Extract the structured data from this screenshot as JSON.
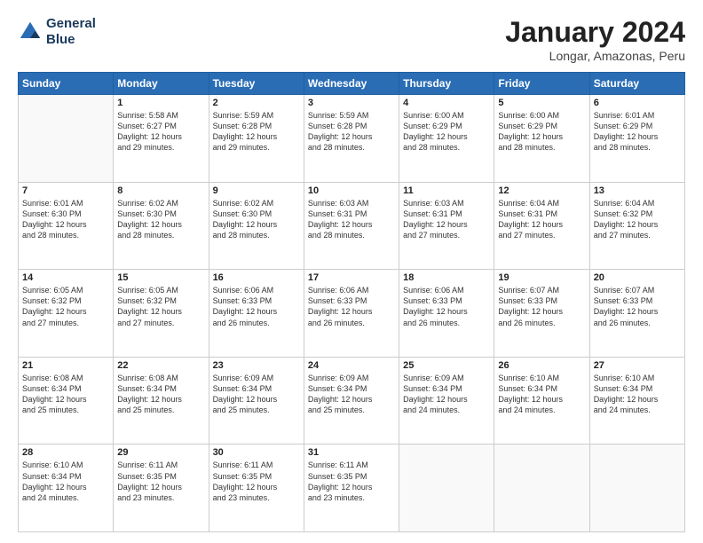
{
  "logo": {
    "line1": "General",
    "line2": "Blue"
  },
  "title": "January 2024",
  "subtitle": "Longar, Amazonas, Peru",
  "header": {
    "days": [
      "Sunday",
      "Monday",
      "Tuesday",
      "Wednesday",
      "Thursday",
      "Friday",
      "Saturday"
    ]
  },
  "weeks": [
    [
      {
        "day": "",
        "info": ""
      },
      {
        "day": "1",
        "info": "Sunrise: 5:58 AM\nSunset: 6:27 PM\nDaylight: 12 hours\nand 29 minutes."
      },
      {
        "day": "2",
        "info": "Sunrise: 5:59 AM\nSunset: 6:28 PM\nDaylight: 12 hours\nand 29 minutes."
      },
      {
        "day": "3",
        "info": "Sunrise: 5:59 AM\nSunset: 6:28 PM\nDaylight: 12 hours\nand 28 minutes."
      },
      {
        "day": "4",
        "info": "Sunrise: 6:00 AM\nSunset: 6:29 PM\nDaylight: 12 hours\nand 28 minutes."
      },
      {
        "day": "5",
        "info": "Sunrise: 6:00 AM\nSunset: 6:29 PM\nDaylight: 12 hours\nand 28 minutes."
      },
      {
        "day": "6",
        "info": "Sunrise: 6:01 AM\nSunset: 6:29 PM\nDaylight: 12 hours\nand 28 minutes."
      }
    ],
    [
      {
        "day": "7",
        "info": "Sunrise: 6:01 AM\nSunset: 6:30 PM\nDaylight: 12 hours\nand 28 minutes."
      },
      {
        "day": "8",
        "info": "Sunrise: 6:02 AM\nSunset: 6:30 PM\nDaylight: 12 hours\nand 28 minutes."
      },
      {
        "day": "9",
        "info": "Sunrise: 6:02 AM\nSunset: 6:30 PM\nDaylight: 12 hours\nand 28 minutes."
      },
      {
        "day": "10",
        "info": "Sunrise: 6:03 AM\nSunset: 6:31 PM\nDaylight: 12 hours\nand 28 minutes."
      },
      {
        "day": "11",
        "info": "Sunrise: 6:03 AM\nSunset: 6:31 PM\nDaylight: 12 hours\nand 27 minutes."
      },
      {
        "day": "12",
        "info": "Sunrise: 6:04 AM\nSunset: 6:31 PM\nDaylight: 12 hours\nand 27 minutes."
      },
      {
        "day": "13",
        "info": "Sunrise: 6:04 AM\nSunset: 6:32 PM\nDaylight: 12 hours\nand 27 minutes."
      }
    ],
    [
      {
        "day": "14",
        "info": "Sunrise: 6:05 AM\nSunset: 6:32 PM\nDaylight: 12 hours\nand 27 minutes."
      },
      {
        "day": "15",
        "info": "Sunrise: 6:05 AM\nSunset: 6:32 PM\nDaylight: 12 hours\nand 27 minutes."
      },
      {
        "day": "16",
        "info": "Sunrise: 6:06 AM\nSunset: 6:33 PM\nDaylight: 12 hours\nand 26 minutes."
      },
      {
        "day": "17",
        "info": "Sunrise: 6:06 AM\nSunset: 6:33 PM\nDaylight: 12 hours\nand 26 minutes."
      },
      {
        "day": "18",
        "info": "Sunrise: 6:06 AM\nSunset: 6:33 PM\nDaylight: 12 hours\nand 26 minutes."
      },
      {
        "day": "19",
        "info": "Sunrise: 6:07 AM\nSunset: 6:33 PM\nDaylight: 12 hours\nand 26 minutes."
      },
      {
        "day": "20",
        "info": "Sunrise: 6:07 AM\nSunset: 6:33 PM\nDaylight: 12 hours\nand 26 minutes."
      }
    ],
    [
      {
        "day": "21",
        "info": "Sunrise: 6:08 AM\nSunset: 6:34 PM\nDaylight: 12 hours\nand 25 minutes."
      },
      {
        "day": "22",
        "info": "Sunrise: 6:08 AM\nSunset: 6:34 PM\nDaylight: 12 hours\nand 25 minutes."
      },
      {
        "day": "23",
        "info": "Sunrise: 6:09 AM\nSunset: 6:34 PM\nDaylight: 12 hours\nand 25 minutes."
      },
      {
        "day": "24",
        "info": "Sunrise: 6:09 AM\nSunset: 6:34 PM\nDaylight: 12 hours\nand 25 minutes."
      },
      {
        "day": "25",
        "info": "Sunrise: 6:09 AM\nSunset: 6:34 PM\nDaylight: 12 hours\nand 24 minutes."
      },
      {
        "day": "26",
        "info": "Sunrise: 6:10 AM\nSunset: 6:34 PM\nDaylight: 12 hours\nand 24 minutes."
      },
      {
        "day": "27",
        "info": "Sunrise: 6:10 AM\nSunset: 6:34 PM\nDaylight: 12 hours\nand 24 minutes."
      }
    ],
    [
      {
        "day": "28",
        "info": "Sunrise: 6:10 AM\nSunset: 6:34 PM\nDaylight: 12 hours\nand 24 minutes."
      },
      {
        "day": "29",
        "info": "Sunrise: 6:11 AM\nSunset: 6:35 PM\nDaylight: 12 hours\nand 23 minutes."
      },
      {
        "day": "30",
        "info": "Sunrise: 6:11 AM\nSunset: 6:35 PM\nDaylight: 12 hours\nand 23 minutes."
      },
      {
        "day": "31",
        "info": "Sunrise: 6:11 AM\nSunset: 6:35 PM\nDaylight: 12 hours\nand 23 minutes."
      },
      {
        "day": "",
        "info": ""
      },
      {
        "day": "",
        "info": ""
      },
      {
        "day": "",
        "info": ""
      }
    ]
  ]
}
